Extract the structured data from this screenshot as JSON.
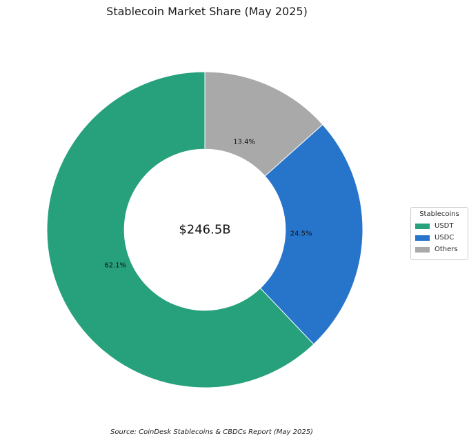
{
  "page": {
    "title": "Stablecoin Market Share (May 2025)"
  },
  "chart_data": {
    "type": "pie",
    "subtype": "donut",
    "title": "Stablecoin Market Share (May 2025)",
    "categories": [
      "USDT",
      "USDC",
      "Others"
    ],
    "values": [
      62.1,
      24.5,
      13.4
    ],
    "value_labels": [
      "62.1%",
      "24.5%",
      "13.4%"
    ],
    "colors": [
      "#26a17b",
      "#2775ca",
      "#a9a9a9"
    ],
    "center_label": "$246.5B",
    "legend": {
      "title": "Stablecoins",
      "position": "center right",
      "border_color": "#cccccc"
    },
    "start_angle": 90,
    "direction": "counterclockwise",
    "donut_hole_ratio": 0.51,
    "source": "Source: CoinDesk Stablecoins & CBDCs Report (May 2025)"
  }
}
